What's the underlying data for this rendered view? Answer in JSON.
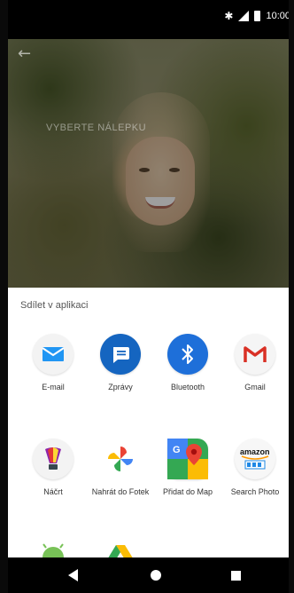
{
  "status_bar": {
    "time": "10:00",
    "icons": [
      "bluetooth-icon",
      "signal-icon",
      "battery-icon"
    ]
  },
  "photo": {
    "caption": "VYBERTE NÁLEPKU",
    "back_icon": "arrow-back-icon"
  },
  "share_sheet": {
    "title": "Sdílet v aplikaci",
    "apps": [
      {
        "label": "E-mail",
        "icon": "email-icon"
      },
      {
        "label": "Zprávy",
        "icon": "messages-icon"
      },
      {
        "label": "Bluetooth",
        "icon": "bluetooth-icon"
      },
      {
        "label": "Gmail",
        "icon": "gmail-icon"
      },
      {
        "label": "Náčrt",
        "icon": "sketch-icon"
      },
      {
        "label": "Nahrát do Fotek",
        "icon": "google-photos-icon"
      },
      {
        "label": "Přidat do Map",
        "icon": "google-maps-icon"
      },
      {
        "label": "Search Photo",
        "icon": "amazon-icon"
      },
      {
        "label": "",
        "icon": "android-icon"
      },
      {
        "label": "",
        "icon": "google-drive-icon"
      }
    ]
  },
  "nav_bar": {
    "buttons": [
      "back-icon",
      "home-icon",
      "recents-icon"
    ]
  },
  "colors": {
    "email_blue": "#2196f3",
    "messages_blue": "#1565c0",
    "bluetooth_blue": "#1e6fd9",
    "gmail_red": "#d93025",
    "amazon_orange": "#ff9900"
  }
}
